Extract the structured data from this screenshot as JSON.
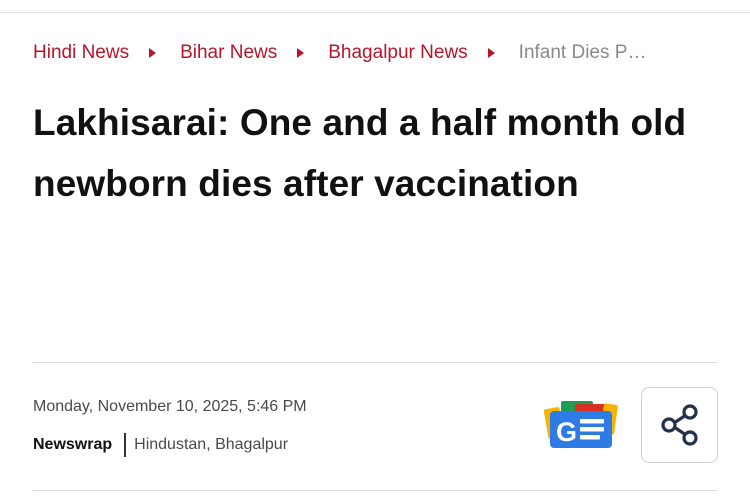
{
  "breadcrumb": {
    "items": [
      {
        "label": "Hindi News"
      },
      {
        "label": "Bihar News"
      },
      {
        "label": "Bhagalpur News"
      },
      {
        "label": "Infant Dies P…"
      }
    ]
  },
  "article": {
    "headline_line1": "Lakhisarai: One and a half month old",
    "headline_line2": "newborn dies after vaccination",
    "date": "Monday, November 10, 2025, 5:46 PM",
    "author": "Newswrap",
    "source": "Hindustan, Bhagalpur"
  },
  "actions": {
    "google_news_icon": "google-news-icon",
    "share_icon": "share-icon"
  },
  "colors": {
    "link": "#b8142a",
    "muted": "#8a8a8a",
    "text": "#111111"
  }
}
